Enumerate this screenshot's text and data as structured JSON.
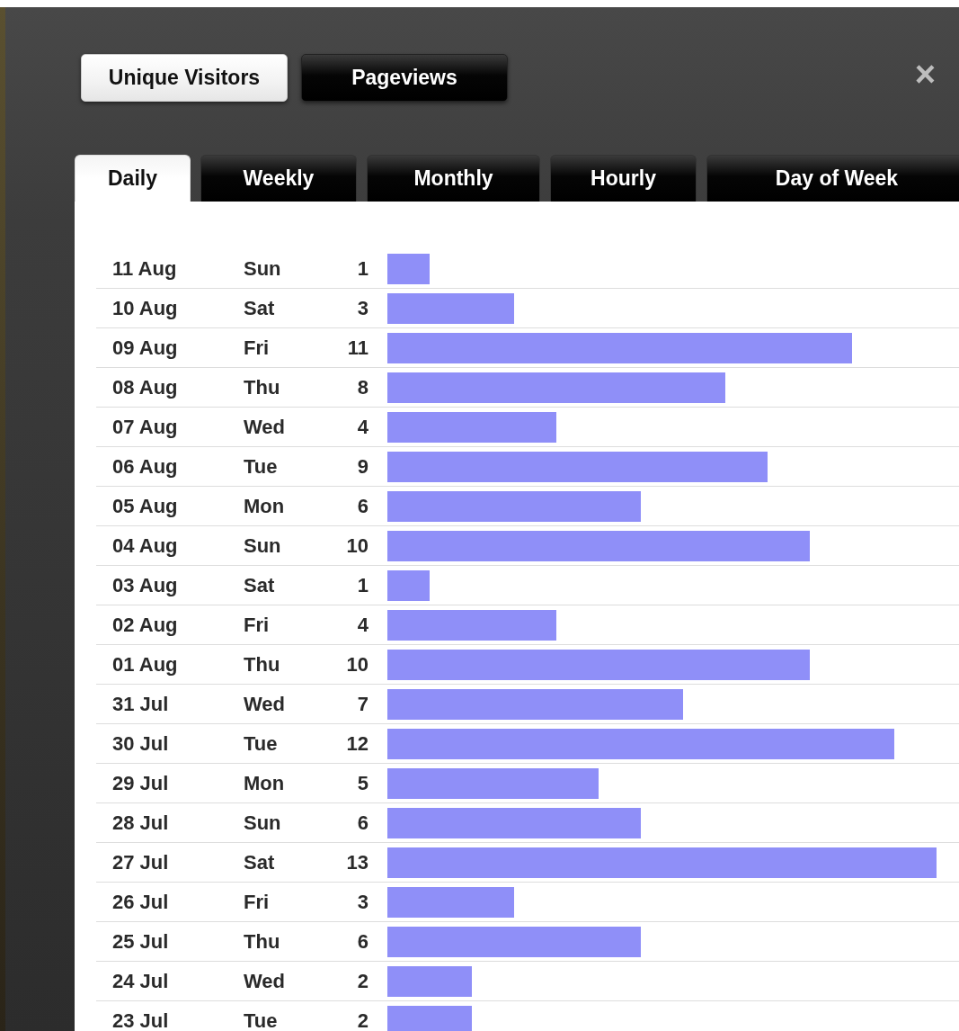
{
  "metric_buttons": [
    {
      "label": "Unique Visitors",
      "selected": true
    },
    {
      "label": "Pageviews",
      "selected": false
    }
  ],
  "close": "×",
  "tabs": [
    {
      "label": "Daily",
      "selected": true
    },
    {
      "label": "Weekly",
      "selected": false
    },
    {
      "label": "Monthly",
      "selected": false
    },
    {
      "label": "Hourly",
      "selected": false
    },
    {
      "label": "Day of Week",
      "selected": false
    }
  ],
  "rows": [
    {
      "date": "11 Aug",
      "day": "Sun",
      "count": "1"
    },
    {
      "date": "10 Aug",
      "day": "Sat",
      "count": "3"
    },
    {
      "date": "09 Aug",
      "day": "Fri",
      "count": "11"
    },
    {
      "date": "08 Aug",
      "day": "Thu",
      "count": "8"
    },
    {
      "date": "07 Aug",
      "day": "Wed",
      "count": "4"
    },
    {
      "date": "06 Aug",
      "day": "Tue",
      "count": "9"
    },
    {
      "date": "05 Aug",
      "day": "Mon",
      "count": "6"
    },
    {
      "date": "04 Aug",
      "day": "Sun",
      "count": "10"
    },
    {
      "date": "03 Aug",
      "day": "Sat",
      "count": "1"
    },
    {
      "date": "02 Aug",
      "day": "Fri",
      "count": "4"
    },
    {
      "date": "01 Aug",
      "day": "Thu",
      "count": "10"
    },
    {
      "date": "31 Jul",
      "day": "Wed",
      "count": "7"
    },
    {
      "date": "30 Jul",
      "day": "Tue",
      "count": "12"
    },
    {
      "date": "29 Jul",
      "day": "Mon",
      "count": "5"
    },
    {
      "date": "28 Jul",
      "day": "Sun",
      "count": "6"
    },
    {
      "date": "27 Jul",
      "day": "Sat",
      "count": "13"
    },
    {
      "date": "26 Jul",
      "day": "Fri",
      "count": "3"
    },
    {
      "date": "25 Jul",
      "day": "Thu",
      "count": "6"
    },
    {
      "date": "24 Jul",
      "day": "Wed",
      "count": "2"
    },
    {
      "date": "23 Jul",
      "day": "Tue",
      "count": "2"
    }
  ]
}
